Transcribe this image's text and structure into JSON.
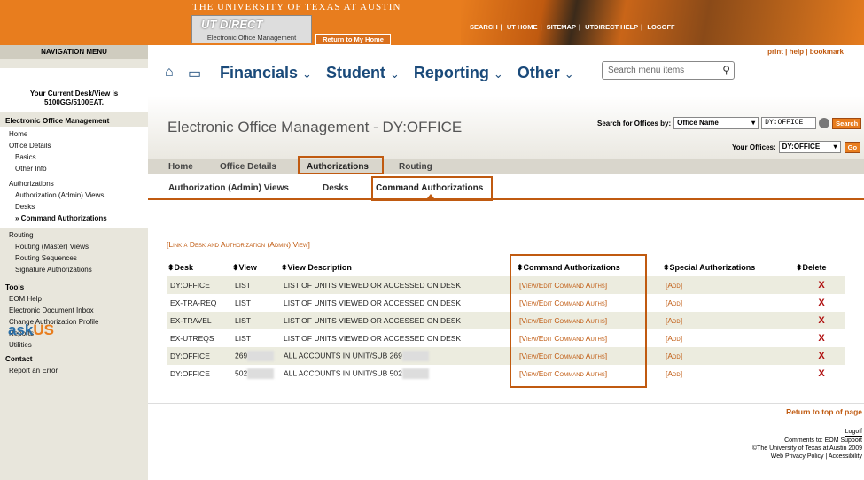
{
  "banner": {
    "university": "THE UNIVERSITY OF TEXAS AT AUSTIN",
    "logo_text": "UT DIRECT",
    "logo_sub": "Electronic Office Management",
    "return_home": "Return to My Home",
    "links": [
      "SEARCH",
      "UT HOME",
      "SITEMAP",
      "UTDIRECT HELP",
      "LOGOFF"
    ]
  },
  "top_right_links": [
    "print",
    "help",
    "bookmark"
  ],
  "nav": {
    "header": "NAVIGATION MENU",
    "desk_line1": "Your Current Desk/View is",
    "desk_line2": "5100GG/5100EAT.",
    "eom_title": "Electronic Office Management",
    "home": "Home",
    "office_details": "Office Details",
    "basics": "Basics",
    "other_info": "Other Info",
    "authorizations": "Authorizations",
    "auth_admin_views": "Authorization (Admin) Views",
    "desks": "Desks",
    "command_auths": "» Command Authorizations",
    "routing": "Routing",
    "routing_master": "Routing (Master) Views",
    "routing_sequences": "Routing Sequences",
    "signature_auths": "Signature Authorizations",
    "tools": "Tools",
    "tools_items": [
      "EOM Help",
      "Electronic Document Inbox",
      "Change Authorization Profile",
      "Reports",
      "Utilities"
    ],
    "contact": "Contact",
    "report_error": "Report an Error",
    "ask": "ask",
    "us": "US"
  },
  "mainnav": {
    "items": [
      "Financials",
      "Student",
      "Reporting",
      "Other"
    ],
    "search_placeholder": "Search menu items"
  },
  "page": {
    "title": "Electronic Office Management - DY:OFFICE",
    "search_label": "Search for Offices by:",
    "search_by": "Office Name",
    "search_value": "DY:OFFICE",
    "search_btn": "Search",
    "your_offices_label": "Your Offices:",
    "your_office_value": "DY:OFFICE",
    "go": "Go"
  },
  "tabs1": [
    "Home",
    "Office Details",
    "Authorizations",
    "Routing"
  ],
  "tabs2": [
    "Authorization (Admin) Views",
    "Desks",
    "Command Authorizations"
  ],
  "link_desk": "[Link a Desk and Authorization (Admin) View]",
  "table": {
    "headers": [
      "Desk",
      "View",
      "View Description",
      "Command Authorizations",
      "Special Authorizations",
      "Delete"
    ],
    "rows": [
      {
        "desk": "DY:OFFICE",
        "view": "LIST",
        "desc": "LIST OF UNITS VIEWED OR ACCESSED ON DESK",
        "cmd": "[View/Edit Command Auths]",
        "special": "[Add]"
      },
      {
        "desk": "EX-TRA-REQ",
        "view": "LIST",
        "desc": "LIST OF UNITS VIEWED OR ACCESSED ON DESK",
        "cmd": "[View/Edit Command Auths]",
        "special": "[Add]"
      },
      {
        "desk": "EX-TRAVEL",
        "view": "LIST",
        "desc": "LIST OF UNITS VIEWED OR ACCESSED ON DESK",
        "cmd": "[View/Edit Command Auths]",
        "special": "[Add]"
      },
      {
        "desk": "EX-UTREQS",
        "view": "LIST",
        "desc": "LIST OF UNITS VIEWED OR ACCESSED ON DESK",
        "cmd": "[View/Edit Command Auths]",
        "special": "[Add]"
      },
      {
        "desk": "DY:OFFICE",
        "view": "269",
        "desc": "ALL ACCOUNTS IN UNIT/SUB 269",
        "cmd": "[View/Edit Command Auths]",
        "special": "[Add]"
      },
      {
        "desk": "DY:OFFICE",
        "view": "502",
        "desc": "ALL ACCOUNTS IN UNIT/SUB 502",
        "cmd": "[View/Edit Command Auths]",
        "special": "[Add]"
      }
    ],
    "delete_glyph": "X"
  },
  "return_top": "Return to top of page",
  "footer": {
    "logoff": "Logoff",
    "comments": "Comments to: EOM Support",
    "copyright": "©The University of Texas at Austin 2009",
    "links": "Web Privacy Policy | Accessibility"
  },
  "colors": {
    "accent": "#e87d1e",
    "dark_accent": "#c05a10",
    "nav_blue": "#1a4a7a"
  }
}
